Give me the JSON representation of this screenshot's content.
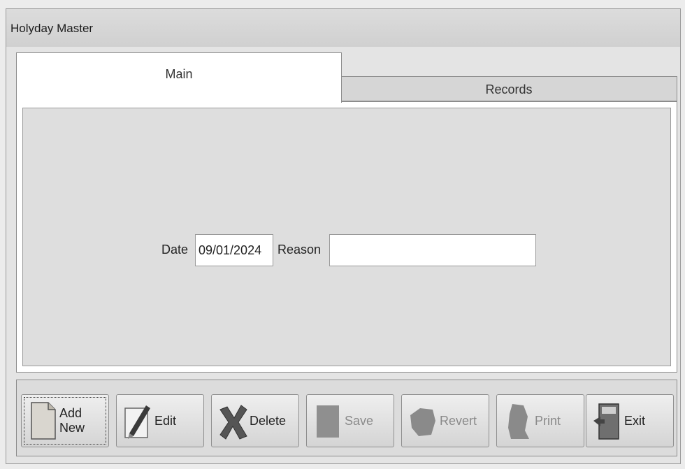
{
  "window": {
    "title": "Holyday Master"
  },
  "tabs": [
    {
      "label": "Main",
      "active": true
    },
    {
      "label": "Records",
      "active": false
    }
  ],
  "form": {
    "date_label": "Date",
    "date_value": "09/01/2024",
    "reason_label": "Reason",
    "reason_value": ""
  },
  "toolbar": {
    "buttons": [
      {
        "label": "Add New",
        "icon": "document-icon",
        "enabled": true,
        "focused": true
      },
      {
        "label": "Edit",
        "icon": "pen-icon",
        "enabled": true
      },
      {
        "label": "Delete",
        "icon": "delete-x-icon",
        "enabled": true
      },
      {
        "label": "Save",
        "icon": "save-icon",
        "enabled": false
      },
      {
        "label": "Revert",
        "icon": "revert-icon",
        "enabled": false
      },
      {
        "label": "Print",
        "icon": "print-icon",
        "enabled": false
      },
      {
        "label": "Exit",
        "icon": "exit-door-icon",
        "enabled": true
      }
    ]
  }
}
